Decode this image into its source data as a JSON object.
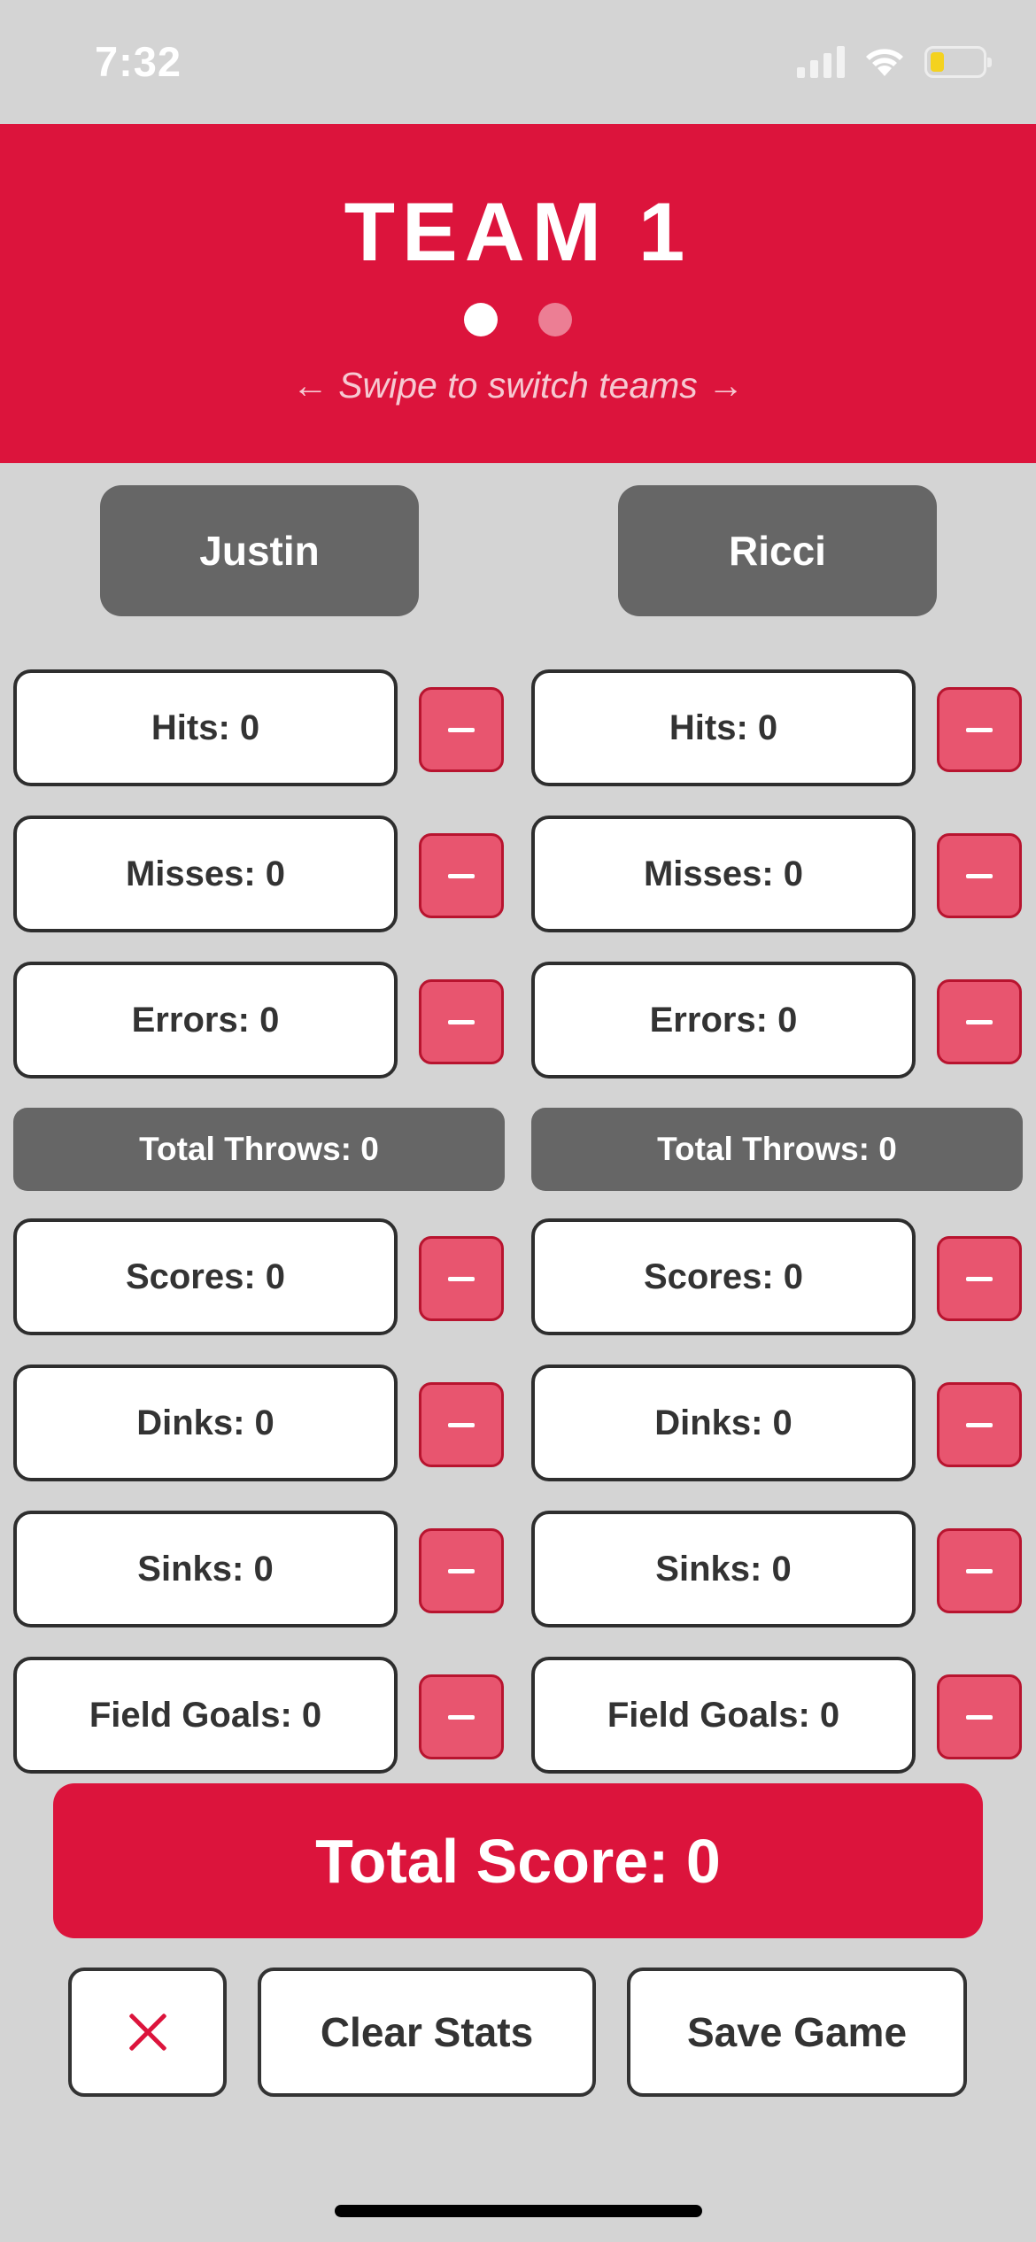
{
  "status_bar": {
    "time": "7:32",
    "battery_level": 0.25
  },
  "header": {
    "title": "TEAM 1",
    "swipe_hint": "← Swipe to switch teams →",
    "pages": 2,
    "active_page": 0
  },
  "players": [
    {
      "name": "Justin",
      "stats": {
        "hits": "Hits: 0",
        "misses": "Misses: 0",
        "errors": "Errors: 0",
        "total_throws": "Total Throws: 0",
        "scores": "Scores: 0",
        "dinks": "Dinks: 0",
        "sinks": "Sinks: 0",
        "field_goals": "Field Goals: 0"
      }
    },
    {
      "name": "Ricci",
      "stats": {
        "hits": "Hits: 0",
        "misses": "Misses: 0",
        "errors": "Errors: 0",
        "total_throws": "Total Throws: 0",
        "scores": "Scores: 0",
        "dinks": "Dinks: 0",
        "sinks": "Sinks: 0",
        "field_goals": "Field Goals: 0"
      }
    }
  ],
  "total_score": "Total Score: 0",
  "actions": {
    "clear_label": "Clear Stats",
    "save_label": "Save Game"
  },
  "colors": {
    "accent": "#dc143c",
    "background": "#d4d4d4",
    "dark_gray": "#666666",
    "minus_pink": "#e8556f"
  }
}
